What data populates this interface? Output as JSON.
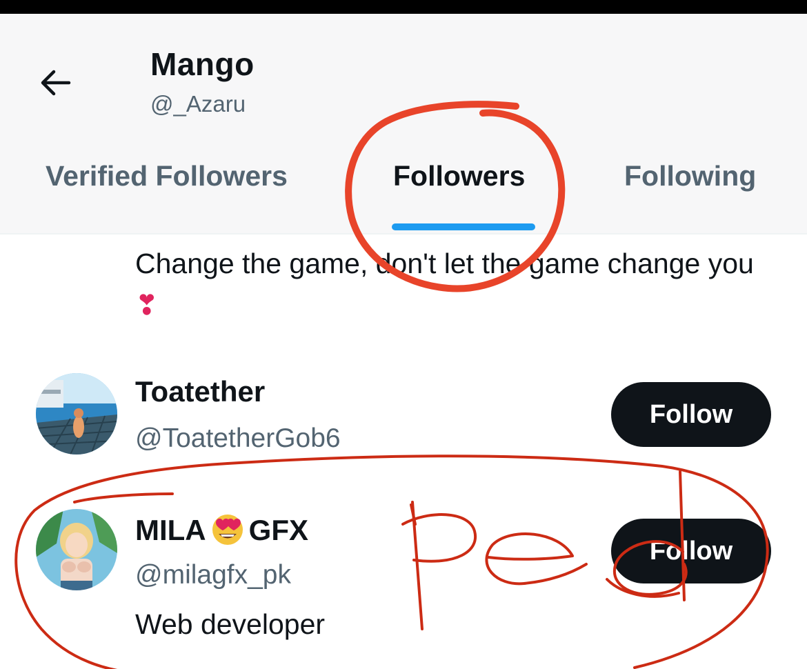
{
  "header": {
    "back_icon": "arrow-left-icon",
    "title": "Mango",
    "handle": "@_Azaru"
  },
  "tabs": [
    {
      "label": "Verified Followers",
      "active": false
    },
    {
      "label": "Followers",
      "active": true
    },
    {
      "label": "Following",
      "active": false
    }
  ],
  "previous_bio": {
    "text": "Change the game, don't let the game change you",
    "emoji": "❣"
  },
  "users": [
    {
      "name": "Toatether",
      "handle": "@ToatetherGob6",
      "follow_label": "Follow"
    },
    {
      "name_part1": "MILA",
      "name_emoji": "heart-eyes-emoji",
      "name_part2": "GFX",
      "handle": "@milagfx_pk",
      "bio": "Web developer",
      "follow_label": "Follow"
    }
  ],
  "colors": {
    "accent": "#1d9bf0",
    "annotation": "#e8442a",
    "button": "#0f1419"
  }
}
